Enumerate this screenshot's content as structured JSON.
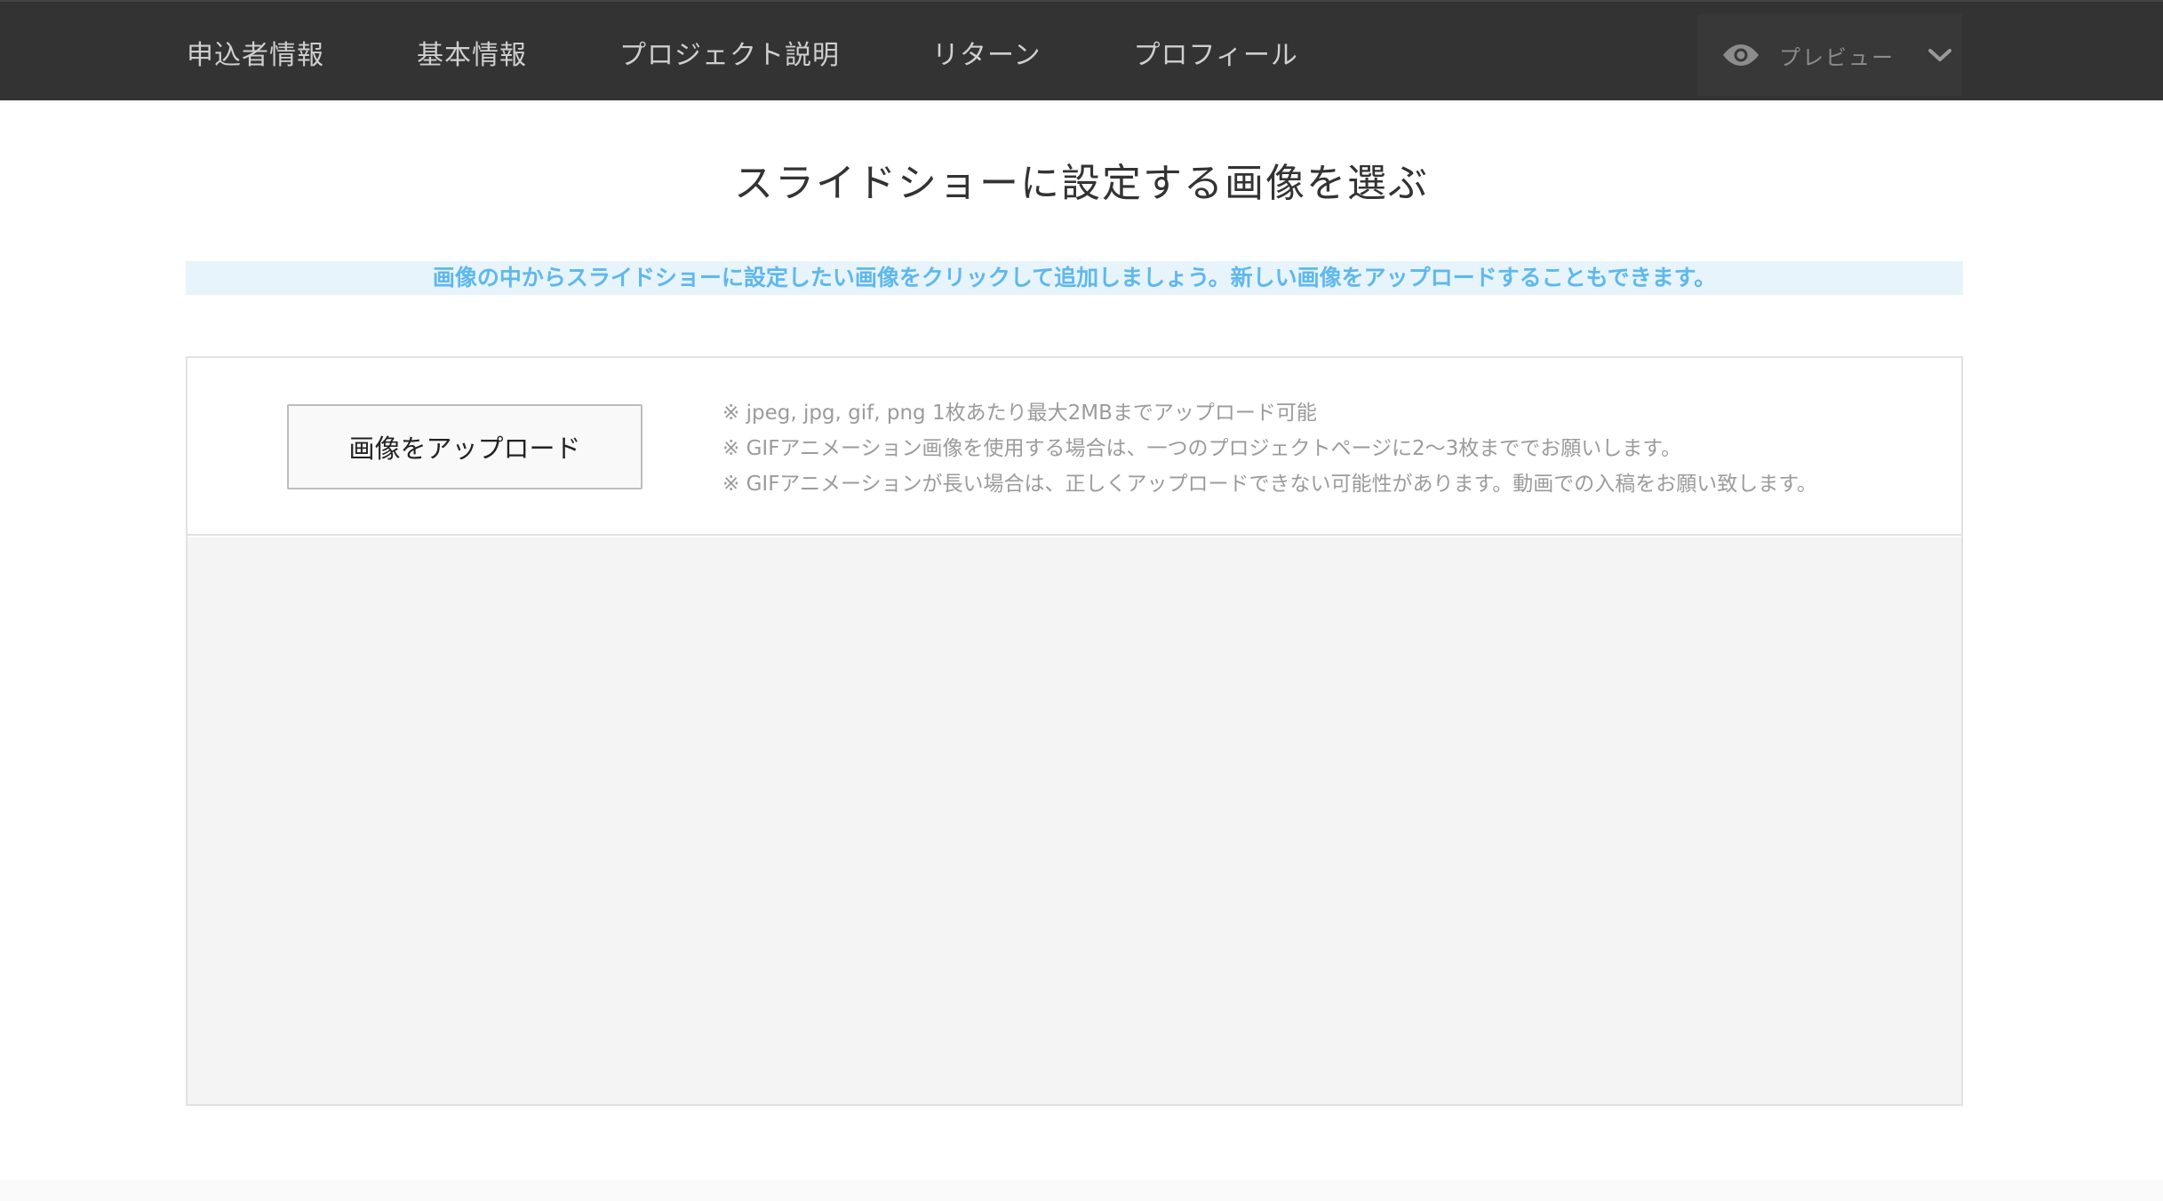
{
  "nav": {
    "tabs": [
      {
        "label": "申込者情報"
      },
      {
        "label": "基本情報"
      },
      {
        "label": "プロジェクト説明"
      },
      {
        "label": "リターン"
      },
      {
        "label": "プロフィール"
      }
    ],
    "preview": {
      "label": "プレビュー",
      "icon": "eye-icon",
      "dropdown_icon": "chevron-down-icon"
    }
  },
  "main": {
    "title": "スライドショーに設定する画像を選ぶ",
    "info": "画像の中からスライドショーに設定したい画像をクリックして追加しましょう。新しい画像をアップロードすることもできます。",
    "upload_label": "画像をアップロード",
    "notes": [
      "※ jpeg, jpg, gif, png 1枚あたり最大2MBまでアップロード可能",
      "※ GIFアニメーション画像を使用する場合は、一つのプロジェクトページに2〜3枚まででお願いします。",
      "※ GIFアニメーションが長い場合は、正しくアップロードできない可能性があります。動画での入稿をお願い致します。"
    ]
  },
  "colors": {
    "nav_bg": "#333333",
    "info_bg": "#e7f4fc",
    "info_text": "#5fb8ec",
    "panel_bg": "#f4f4f4"
  }
}
